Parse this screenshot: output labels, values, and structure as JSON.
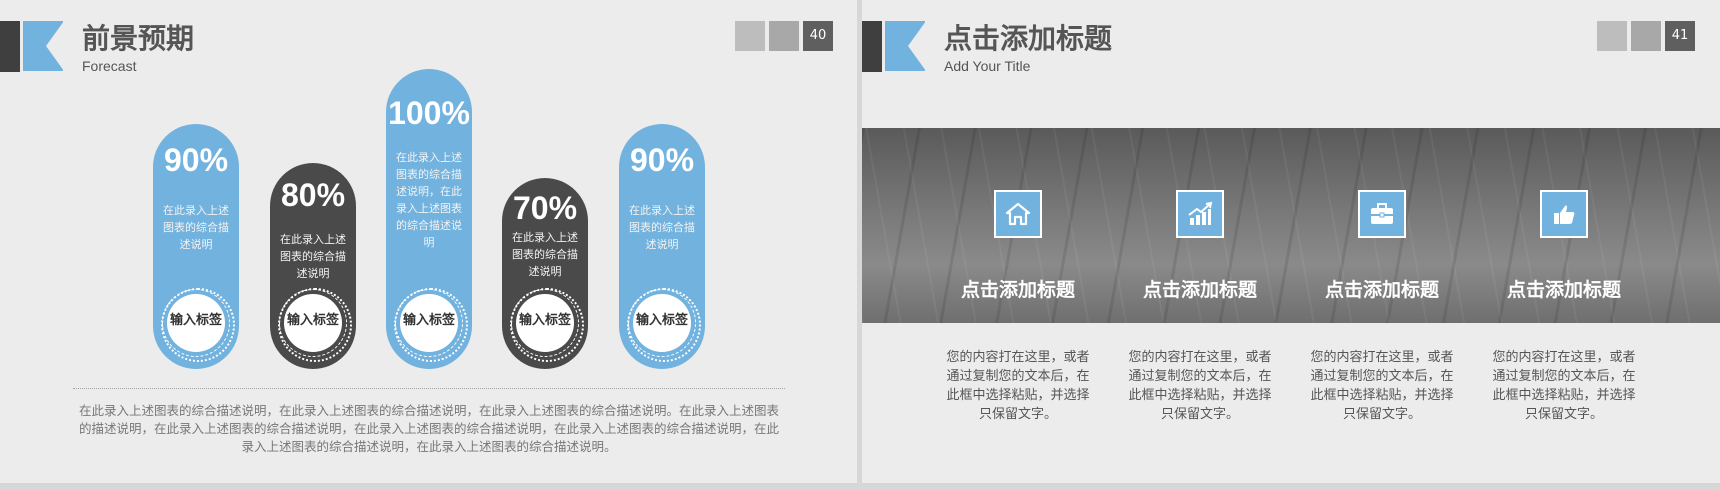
{
  "slide40": {
    "title": "前景预期",
    "subtitle": "Forecast",
    "page_number": "40",
    "pills": [
      {
        "percent": "90%",
        "desc": "在此录入上述图表的综合描述说明",
        "label": "输入标签",
        "color": "blue"
      },
      {
        "percent": "80%",
        "desc": "在此录入上述图表的综合描述说明",
        "label": "输入标签",
        "color": "dark"
      },
      {
        "percent": "100%",
        "desc": "在此录入上述图表的综合描述说明，在此录入上述图表的综合描述说明",
        "label": "输入标签",
        "color": "blue"
      },
      {
        "percent": "70%",
        "desc": "在此录入上述图表的综合描述说明",
        "label": "输入标签",
        "color": "dark"
      },
      {
        "percent": "90%",
        "desc": "在此录入上述图表的综合描述说明",
        "label": "输入标签",
        "color": "blue"
      }
    ],
    "summary": "在此录入上述图表的综合描述说明，在此录入上述图表的综合描述说明，在此录入上述图表的综合描述说明。在此录入上述图表的描述说明，在此录入上述图表的综合描述说明，在此录入上述图表的综合描述说明，在此录入上述图表的综合描述说明，在此录入上述图表的综合描述说明，在此录入上述图表的综合描述说明。"
  },
  "slide41": {
    "title": "点击添加标题",
    "subtitle": "Add Your Title",
    "page_number": "41",
    "columns": [
      {
        "icon": "home-icon",
        "title": "点击添加标题",
        "text": "您的内容打在这里，或者通过复制您的文本后，在此框中选择粘贴，并选择只保留文字。"
      },
      {
        "icon": "chart-growth-icon",
        "title": "点击添加标题",
        "text": "您的内容打在这里，或者通过复制您的文本后，在此框中选择粘贴，并选择只保留文字。"
      },
      {
        "icon": "briefcase-icon",
        "title": "点击添加标题",
        "text": "您的内容打在这里，或者通过复制您的文本后，在此框中选择粘贴，并选择只保留文字。"
      },
      {
        "icon": "thumbs-up-icon",
        "title": "点击添加标题",
        "text": "您的内容打在这里，或者通过复制您的文本后，在此框中选择粘贴，并选择只保留文字。"
      }
    ]
  },
  "colors": {
    "accent_blue": "#72b2df",
    "dark_gray": "#4a4a4a",
    "background": "#ececec"
  }
}
